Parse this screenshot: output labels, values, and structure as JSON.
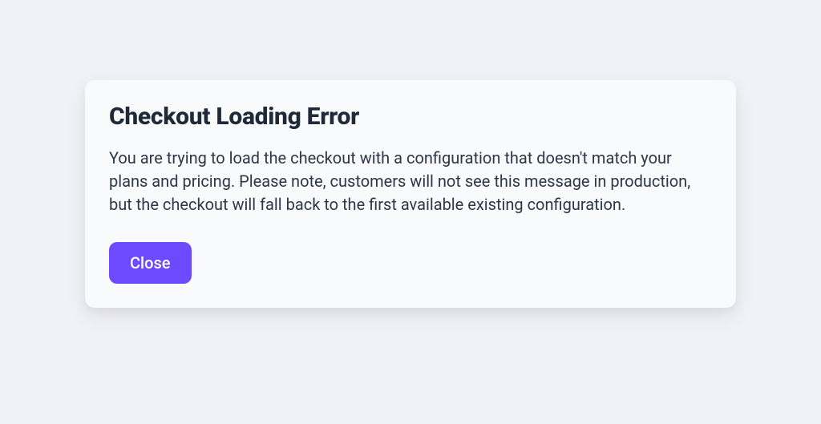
{
  "dialog": {
    "title": "Checkout Loading Error",
    "message": "You are trying to load the checkout with a configuration that doesn't match your plans and pricing. Please note, customers will not see this message in production, but the checkout will fall back to the first available existing configuration.",
    "close_label": "Close"
  }
}
